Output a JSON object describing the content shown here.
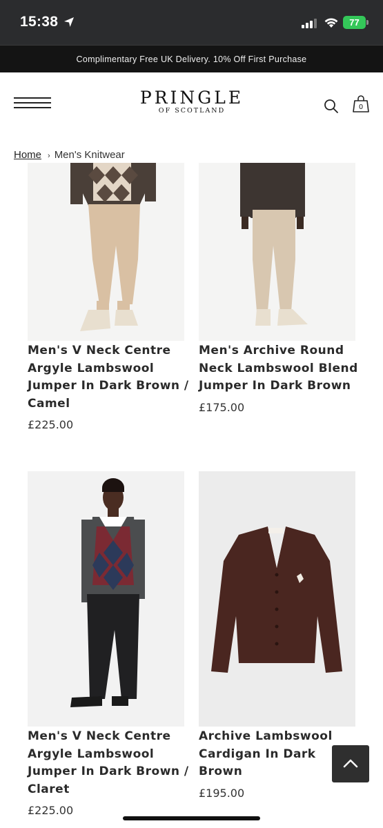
{
  "status_bar": {
    "time": "15:38",
    "battery": "77"
  },
  "promo": {
    "text": "Complimentary Free UK Delivery. 10% Off First Purchase"
  },
  "brand": {
    "name": "PRINGLE",
    "sub": "OF SCOTLAND"
  },
  "cart": {
    "count": "0"
  },
  "breadcrumb": {
    "home": "Home",
    "separator": "›",
    "current": "Men's Knitwear"
  },
  "products": [
    {
      "name": "Men's V Neck Centre Argyle Lambswool Jumper In Dark Brown / Camel",
      "price": "£225.00"
    },
    {
      "name": "Men's Archive Round Neck Lambswool Blend Jumper In Dark Brown",
      "price": "£175.00"
    },
    {
      "name": "Men's V Neck Centre Argyle Lambswool Jumper In Dark Brown / Claret",
      "price": "£225.00"
    },
    {
      "name": "Archive Lambswool Cardigan In Dark Brown",
      "price": "£195.00"
    }
  ],
  "colors": {
    "status_bar": "#2b2c2e",
    "promo_bg": "#141414",
    "accent": "#34c759"
  },
  "icons": [
    "location-arrow-icon",
    "signal-icon",
    "wifi-icon",
    "battery-icon",
    "menu-icon",
    "search-icon",
    "bag-icon",
    "chevron-up-icon"
  ]
}
